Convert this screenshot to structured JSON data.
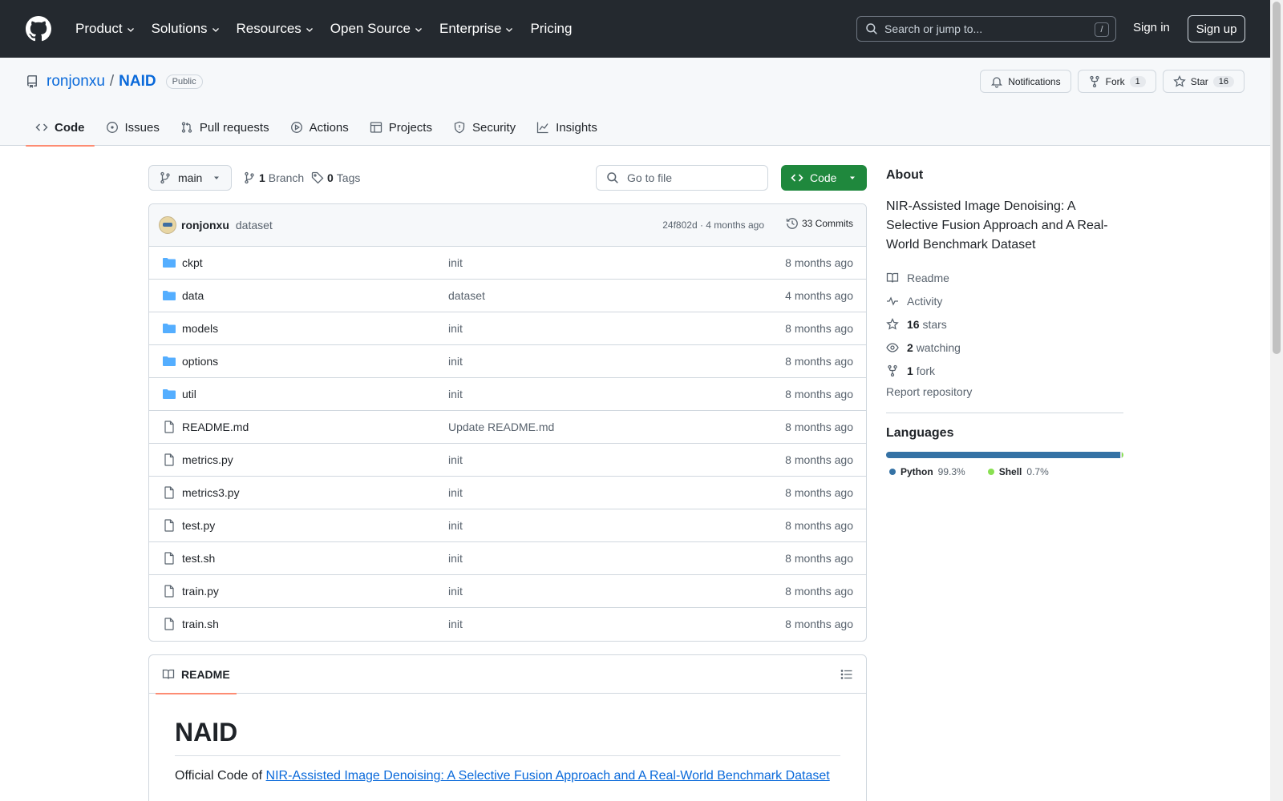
{
  "topnav": {
    "items": [
      {
        "label": "Product",
        "dropdown": true
      },
      {
        "label": "Solutions",
        "dropdown": true
      },
      {
        "label": "Resources",
        "dropdown": true
      },
      {
        "label": "Open Source",
        "dropdown": true
      },
      {
        "label": "Enterprise",
        "dropdown": true
      },
      {
        "label": "Pricing",
        "dropdown": false
      }
    ],
    "search_placeholder": "Search or jump to...",
    "search_shortcut": "/",
    "sign_in": "Sign in",
    "sign_up": "Sign up"
  },
  "repo": {
    "owner": "ronjonxu",
    "separator": "/",
    "name": "NAID",
    "visibility": "Public",
    "notifications_label": "Notifications",
    "fork_label": "Fork",
    "fork_count": "1",
    "star_label": "Star",
    "star_count": "16"
  },
  "tabs": [
    {
      "label": "Code",
      "icon": "code-icon",
      "active": true
    },
    {
      "label": "Issues",
      "icon": "issue-icon",
      "active": false
    },
    {
      "label": "Pull requests",
      "icon": "pull-request-icon",
      "active": false
    },
    {
      "label": "Actions",
      "icon": "play-icon",
      "active": false
    },
    {
      "label": "Projects",
      "icon": "table-icon",
      "active": false
    },
    {
      "label": "Security",
      "icon": "shield-icon",
      "active": false
    },
    {
      "label": "Insights",
      "icon": "graph-icon",
      "active": false
    }
  ],
  "toolbar": {
    "branch": "main",
    "branch_count": "1",
    "branch_label": "Branch",
    "tag_count": "0",
    "tag_label": "Tags",
    "goto_placeholder": "Go to file",
    "code_button": "Code"
  },
  "commit": {
    "author": "ronjonxu",
    "message": "dataset",
    "hash_time": "24f802d · 4 months ago",
    "commits_label": "33 Commits"
  },
  "files": [
    {
      "name": "ckpt",
      "type": "dir",
      "message": "init",
      "date": "8 months ago"
    },
    {
      "name": "data",
      "type": "dir",
      "message": "dataset",
      "date": "4 months ago"
    },
    {
      "name": "models",
      "type": "dir",
      "message": "init",
      "date": "8 months ago"
    },
    {
      "name": "options",
      "type": "dir",
      "message": "init",
      "date": "8 months ago"
    },
    {
      "name": "util",
      "type": "dir",
      "message": "init",
      "date": "8 months ago"
    },
    {
      "name": "README.md",
      "type": "file",
      "message": "Update README.md",
      "date": "8 months ago"
    },
    {
      "name": "metrics.py",
      "type": "file",
      "message": "init",
      "date": "8 months ago"
    },
    {
      "name": "metrics3.py",
      "type": "file",
      "message": "init",
      "date": "8 months ago"
    },
    {
      "name": "test.py",
      "type": "file",
      "message": "init",
      "date": "8 months ago"
    },
    {
      "name": "test.sh",
      "type": "file",
      "message": "init",
      "date": "8 months ago"
    },
    {
      "name": "train.py",
      "type": "file",
      "message": "init",
      "date": "8 months ago"
    },
    {
      "name": "train.sh",
      "type": "file",
      "message": "init",
      "date": "8 months ago"
    }
  ],
  "readme": {
    "tab_label": "README",
    "title": "NAID",
    "intro_prefix": "Official Code of ",
    "intro_link": "NIR-Assisted Image Denoising: A Selective Fusion Approach and A Real-World Benchmark Dataset"
  },
  "about": {
    "heading": "About",
    "description": "NIR-Assisted Image Denoising: A Selective Fusion Approach and A Real-World Benchmark Dataset",
    "readme": "Readme",
    "activity": "Activity",
    "stars_count": "16",
    "stars_label": "stars",
    "watching_count": "2",
    "watching_label": "watching",
    "fork_count": "1",
    "fork_label": "fork",
    "report": "Report repository"
  },
  "languages": {
    "heading": "Languages",
    "items": [
      {
        "name": "Python",
        "percent": "99.3%",
        "value": 99.3,
        "color": "#3572A5"
      },
      {
        "name": "Shell",
        "percent": "0.7%",
        "value": 0.7,
        "color": "#89e051"
      }
    ]
  },
  "colors": {
    "header_bg": "#24292f",
    "link": "#0969da",
    "primary_button": "#1f883d",
    "active_tab_underline": "#fd8c73",
    "folder": "#54aeff"
  }
}
